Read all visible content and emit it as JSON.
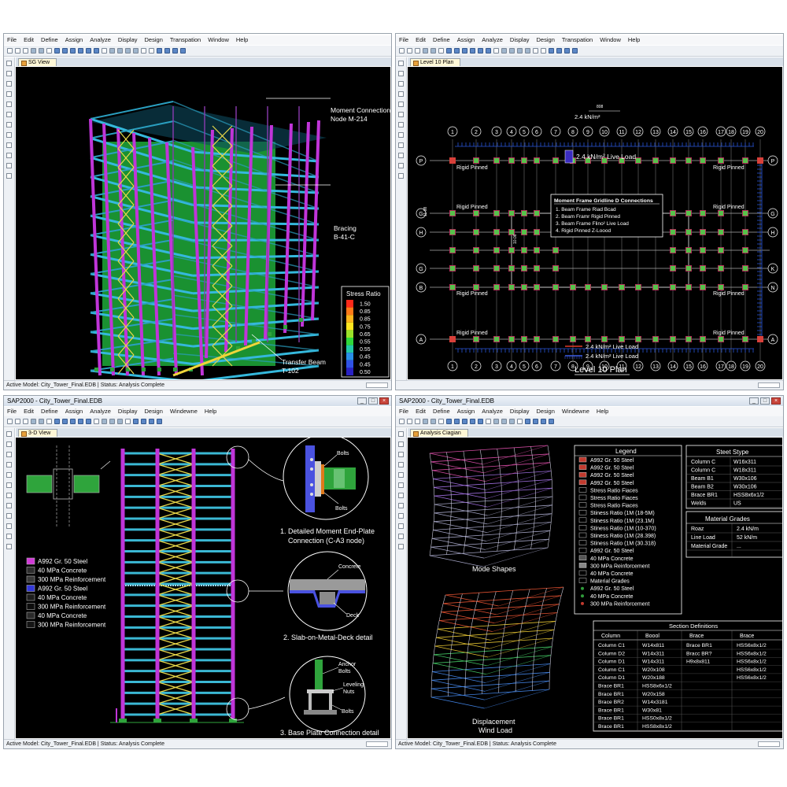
{
  "top_left": {
    "menu": [
      "File",
      "Edit",
      "Define",
      "Assign",
      "Analyze",
      "Display",
      "Design",
      "Transpation",
      "Window",
      "Help"
    ],
    "tab": "SG View",
    "callouts": {
      "moment": [
        "Moment Connection",
        "Node M-214"
      ],
      "bracing": [
        "Bracing",
        "B-41-C"
      ],
      "transfer": [
        "Transfer Beam",
        "T-102"
      ]
    },
    "stress_legend": {
      "title": "Stress Ratio",
      "levels": [
        {
          "value": "1.50",
          "color": "#ff2a1a"
        },
        {
          "value": "0.85",
          "color": "#ff7a18"
        },
        {
          "value": "0.85",
          "color": "#ffb51c"
        },
        {
          "value": "0.75",
          "color": "#ffe51f"
        },
        {
          "value": "0.65",
          "color": "#9be22a"
        },
        {
          "value": "0.55",
          "color": "#2fd83a"
        },
        {
          "value": "0.55",
          "color": "#22c9a6"
        },
        {
          "value": "0.45",
          "color": "#2a8fe8"
        },
        {
          "value": "0.45",
          "color": "#2f52e6"
        },
        {
          "value": "0.50",
          "color": "#2a22c4"
        }
      ]
    },
    "status": "Active Model: City_Tower_Final.EDB  |  Status: Analysis Complete"
  },
  "top_right": {
    "menu": [
      "File",
      "Edit",
      "Define",
      "Assign",
      "Analyze",
      "Display",
      "Design",
      "Transpation",
      "Window",
      "Help"
    ],
    "tab": "Level 10 Plan",
    "grid_numbers": [
      "1",
      "2",
      "3",
      "4",
      "5",
      "6",
      "7",
      "8",
      "9",
      "10",
      "11",
      "12",
      "13",
      "14",
      "15",
      "16",
      "17",
      "18",
      "19",
      "20"
    ],
    "grid_letters_left": [
      "P",
      "G",
      "H",
      "G",
      "B",
      "A"
    ],
    "grid_letters_right": [
      "P",
      "G",
      "H",
      "K",
      "N",
      "A"
    ],
    "dims": {
      "top": "808",
      "left": "11.08"
    },
    "load_top": "2.4 kN/m²",
    "live_load_label": "2.4 kN/m² Live Load",
    "support_label": "Rigid Pinned",
    "moment_box": {
      "title": "Moment Frame Gridline D Connections",
      "items": [
        "1. Beam Frame Riad Bcad",
        "2. Beam Framr Rigid Pinned",
        "3. Beam Frame Flino² Live Load",
        "4. Rigid Pinned Z-Loood"
      ]
    },
    "small_dim": "10.06",
    "legend": [
      "2.4 kN/m² Live Load",
      "2.4 kN/m² Live Load"
    ],
    "plan_title": "Level 10 Plan",
    "status": ""
  },
  "bottom_left": {
    "title": "SAP2000 - City_Tower_Final.EDB",
    "menu": [
      "File",
      "Edit",
      "Define",
      "Assign",
      "Analyze",
      "Display",
      "Design",
      "Windewne",
      "Help"
    ],
    "tab": "3-D View",
    "materials": [
      {
        "label": "A992 Gr. 50 Steel",
        "color": "#d23ad8"
      },
      {
        "label": "40 MPa Concrete",
        "color": "#2d2d2d"
      },
      {
        "label": "300 MPa Reinforcement",
        "color": "#3a3a3a"
      },
      {
        "label": "A992 Gr. 50 Steel",
        "color": "#3338d8"
      },
      {
        "label": "40 MPa Concrete",
        "color": "#1d1d1d"
      },
      {
        "label": "300 MPa Reinforcement",
        "color": "#0d0d0d"
      },
      {
        "label": "40 MPa Concrete",
        "color": "#2a2a2a"
      },
      {
        "label": "300 MPa Reinforcement",
        "color": "#151515"
      }
    ],
    "detail1": {
      "bolts_top": "Bolts",
      "bolts_bottom": "Bolts",
      "caption": [
        "1. Detailed Moment End-Plate",
        "Connection (C-A3 node)"
      ]
    },
    "detail2": {
      "concrete": "Concrete",
      "deck": "Deck",
      "caption": "2. Slab-on-Metal-Deck detail"
    },
    "detail3": {
      "anchor": [
        "Anchor",
        "Bolts"
      ],
      "leveling": [
        "Leveling",
        "Nuts"
      ],
      "bolts": "Bolts",
      "caption": "3. Base Plate Connection detail"
    },
    "status": "Active Model: City_Tower_Final.EDB  |  Status: Analysis Complete"
  },
  "bottom_right": {
    "title": "SAP2000 - City_Tower_Final.EDB",
    "menu": [
      "File",
      "Edit",
      "Define",
      "Assign",
      "Analyze",
      "Display",
      "Design",
      "Windewne",
      "Help"
    ],
    "tab": "Analysis Ciagian",
    "mode_shapes_label": "Mode Shapes",
    "displacement_label": [
      "Displacement",
      "Wind Load"
    ],
    "legend": {
      "title": "Legend",
      "items": [
        {
          "label": "A992 Gr. 50 Steel",
          "color": "#c13a2e"
        },
        {
          "label": "A992 Gr. 50 Steel",
          "color": "#c13a2e"
        },
        {
          "label": "A992 Gr. 50 Steel",
          "color": "#c13a2e"
        },
        {
          "label": "A992 Gr. 50 Steel",
          "color": "#c13a2e"
        },
        {
          "label": "Stress Ratio Fiaces",
          "color": "#000000"
        },
        {
          "label": "Stress Ratio Fiaces",
          "color": "#000000"
        },
        {
          "label": "Stress Ratio Fiaces",
          "color": "#000000"
        },
        {
          "label": "Stiness Ratio (1M (18-5M)",
          "color": "#000000"
        },
        {
          "label": "Stiness Ratio (1M (23.1M)",
          "color": "#000000"
        },
        {
          "label": "Stiness Ratio (1M (10-370)",
          "color": "#000000"
        },
        {
          "label": "Stiness Ratio (1M (28.398)",
          "color": "#000000"
        },
        {
          "label": "Stiness Ratio (1M (30.318)",
          "color": "#000000"
        },
        {
          "label": "A992 Gr. 50 Steel",
          "color": "#000000"
        },
        {
          "label": "40 MPa Concrete",
          "color": "#555555"
        },
        {
          "label": "300 MPa Reinforcement",
          "color": "#888888"
        },
        {
          "label": "40 MPa Concrete",
          "color": "#000000"
        },
        {
          "label": "Material Grades",
          "color": "#000000"
        },
        {
          "label": "A992 Gr. 50 Steel",
          "color": "#2f9b3a"
        },
        {
          "label": "40 MPa Concrete",
          "color": "#2f9b3a"
        },
        {
          "label": "300 MPa Reinforcement",
          "color": "#c13a2e"
        }
      ]
    },
    "steel_type": {
      "title": "Steet Stype",
      "rows": [
        [
          "Column C",
          "W16x311"
        ],
        [
          "Column C",
          "W18x311"
        ],
        [
          "Beam B1",
          "W30x106"
        ],
        [
          "Beam B2",
          "W30x106"
        ],
        [
          "Brace BR1",
          "HSS8x6x1/2"
        ],
        [
          "Welds",
          "US"
        ]
      ]
    },
    "material_grades": {
      "title": "Material Grades",
      "rows": [
        [
          "Roaz",
          "2.4 kN/m"
        ],
        [
          "Line Load",
          "52 kN/m"
        ],
        [
          "Material Grade",
          "..."
        ]
      ]
    },
    "section_defs": {
      "title": "Section Definitions",
      "headers": [
        "Column",
        "Boool",
        "Brace",
        "Brace"
      ],
      "rows": [
        [
          "Column C1",
          "W14x811",
          "Brace BR1",
          "HSS6x8x1/2"
        ],
        [
          "Column D2",
          "W14x311",
          "Bracc BR?",
          "HSS6x8x1/2"
        ],
        [
          "Column D1",
          "W14x311",
          "H9x8x811",
          "HSS6x8x1/2"
        ],
        [
          "Column C1",
          "W20x108",
          "",
          "HSS6x8x1/2"
        ],
        [
          "Column D1",
          "W20x188",
          "",
          "HSS6x8x1/2"
        ],
        [
          "Brace BR1",
          "HSS8x6x1/2",
          "",
          ""
        ],
        [
          "Brace BR1",
          "W20x158",
          "",
          ""
        ],
        [
          "Brace BR2",
          "W14x3181",
          "",
          ""
        ],
        [
          "Brace BR1",
          "W30x81",
          "",
          ""
        ],
        [
          "Brace BR1",
          "HSS0x8x1/2",
          "",
          ""
        ],
        [
          "Brace BR1",
          "HSS8x8x1/2",
          "",
          ""
        ]
      ]
    },
    "status": "Active Model: City_Tower_Final.EDB  |  Status: Analysis Complete"
  }
}
